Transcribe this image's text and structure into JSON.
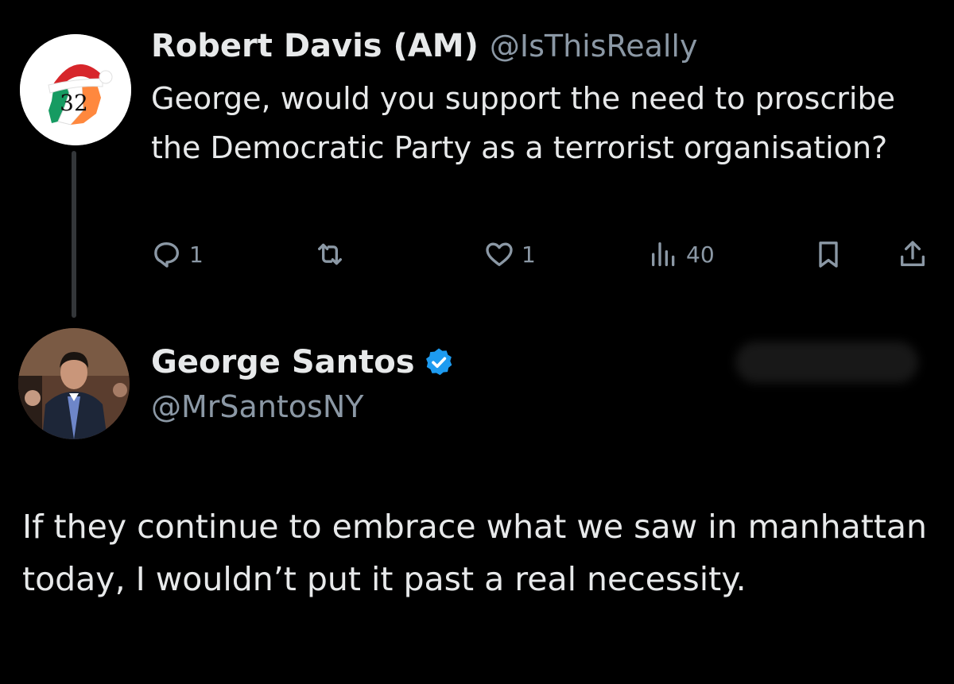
{
  "reply": {
    "author_name": "Robert Davis (AM)",
    "author_handle": "@IsThisReally",
    "text": "George, would you support the need to proscribe the Democratic Party as a terrorist organisation?",
    "avatar_label": "32",
    "actions": {
      "reply_count": "1",
      "retweet_count": "",
      "like_count": "1",
      "views_count": "40"
    }
  },
  "tweet": {
    "author_name": "George Santos",
    "author_handle": "@MrSantosNY",
    "verified": true,
    "text": "If they continue to embrace what we saw in manhattan today, I wouldn’t put it past a real necessity."
  },
  "colors": {
    "background": "#000000",
    "text": "#e7e9ea",
    "secondary": "#8b98a5",
    "verified": "#1d9bf0"
  },
  "icons": [
    "reply-icon",
    "retweet-icon",
    "like-icon",
    "views-icon",
    "bookmark-icon",
    "share-icon",
    "verified-badge-icon"
  ]
}
